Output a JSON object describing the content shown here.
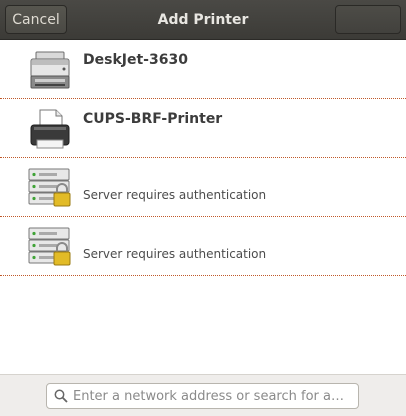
{
  "header": {
    "title": "Add Printer",
    "cancel_label": "Cancel"
  },
  "printers": [
    {
      "name": "DeskJet-3630",
      "description": "",
      "icon": "multifunction-printer-icon"
    },
    {
      "name": "CUPS-BRF-Printer",
      "description": "",
      "icon": "printer-icon"
    },
    {
      "name": "",
      "description": "Server requires authentication",
      "icon": "locked-server-icon"
    },
    {
      "name": "",
      "description": "Server requires authentication",
      "icon": "locked-server-icon"
    }
  ],
  "search": {
    "placeholder": "Enter a network address or search for a…",
    "value": ""
  },
  "colors": {
    "titlebar": "#3c3b37",
    "separator": "#c05a2b",
    "footer": "#efedeb"
  }
}
